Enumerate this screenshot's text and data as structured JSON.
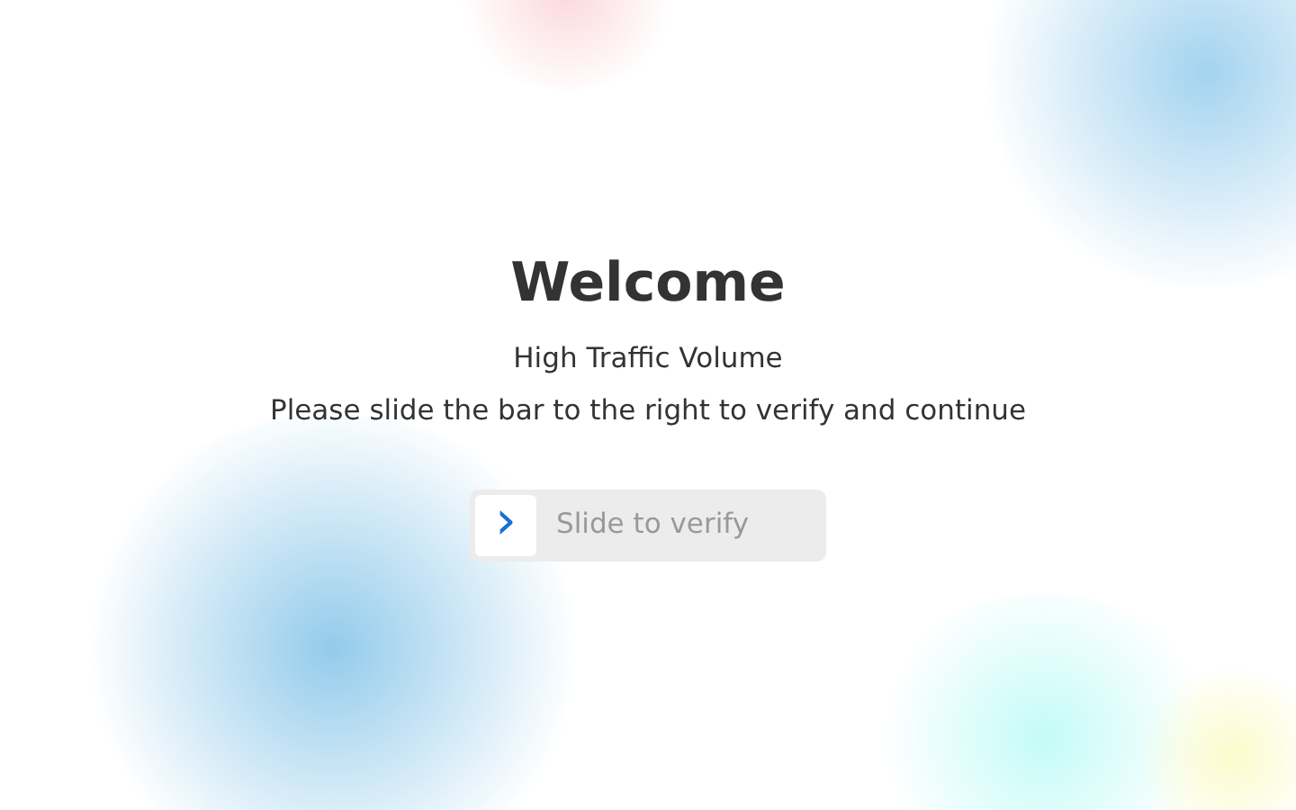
{
  "title": "Welcome",
  "subtitle": "High Traffic Volume",
  "instruction": "Please slide the bar to the right to verify and continue",
  "slider": {
    "label": "Slide to verify",
    "handle": "›",
    "level": 0
  }
}
